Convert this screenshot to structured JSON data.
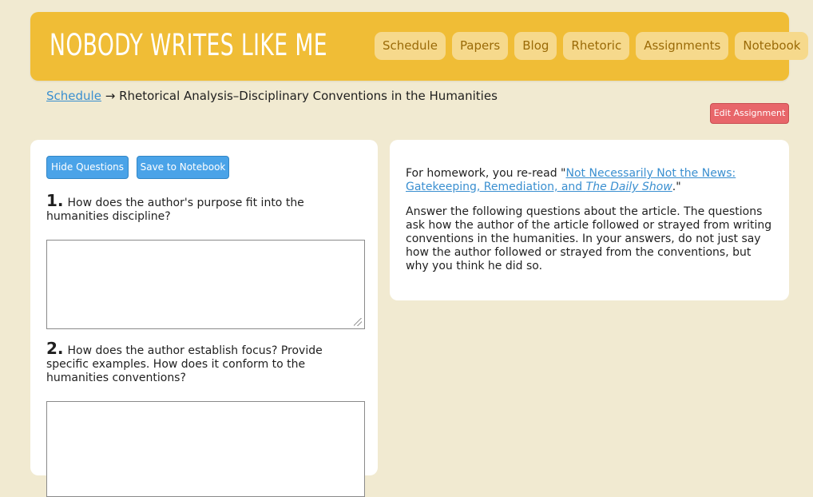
{
  "header": {
    "logo": "NOBODY WRITES LIKE ME",
    "nav": [
      "Schedule",
      "Papers",
      "Blog",
      "Rhetoric",
      "Assignments",
      "Notebook"
    ]
  },
  "breadcrumb": {
    "link": "Schedule",
    "arrow": "→",
    "current": "Rhetorical Analysis–Disciplinary Conventions in the Humanities"
  },
  "edit_button": "Edit Assignment",
  "left": {
    "hide_questions": "Hide Questions",
    "save_notebook": "Save to Notebook",
    "questions": [
      {
        "num": "1.",
        "text": "How does the author's purpose fit into the humanities discipline?",
        "answer": ""
      },
      {
        "num": "2.",
        "text": "How does the author establish focus? Provide specific examples. How does it conform to the humanities conventions?",
        "answer": ""
      }
    ]
  },
  "right": {
    "p1_prefix": "For homework, you re-read \"",
    "p1_link_a": "Not Necessarily Not the News: Gatekeeping, Remediation, and ",
    "p1_link_b": "The Daily Show",
    "p1_suffix": ".\"",
    "p2": "Answer the following questions about the article.  The questions ask how the author of the article followed or strayed from writing conventions in the humanities.  In your answers, do not just say how the author followed or strayed from the conventions, but why you think he did so."
  },
  "colors": {
    "header_bg": "#f0bd36",
    "page_bg": "#f1ead1",
    "nav_bg": "#f6d98c",
    "nav_text": "#9a6a07",
    "button_blue": "#4aa3e8",
    "button_red": "#e8666a",
    "link": "#3a8fd0"
  }
}
